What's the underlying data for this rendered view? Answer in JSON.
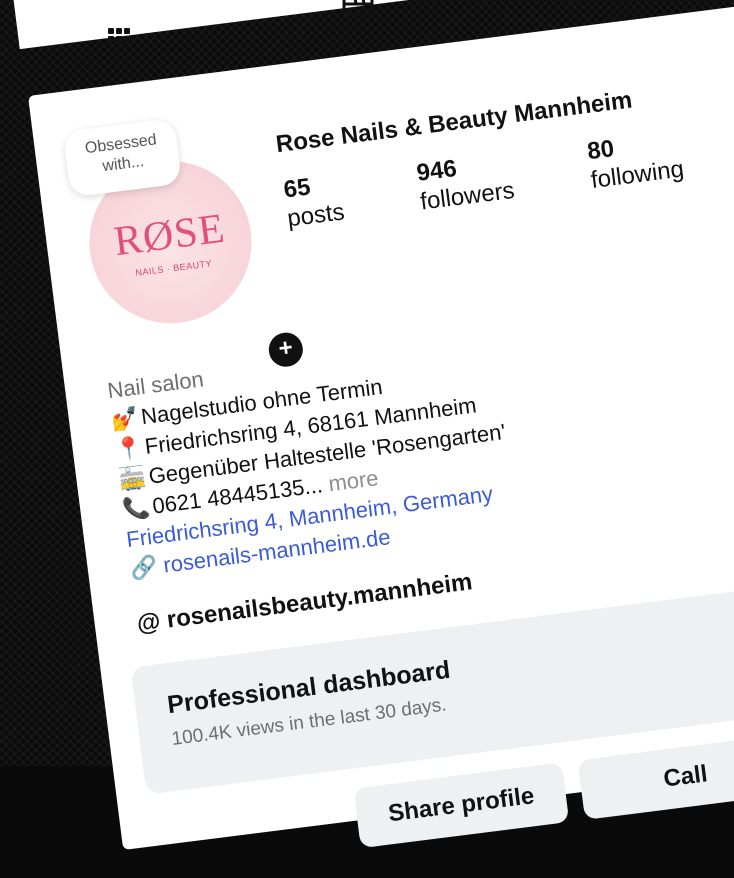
{
  "profile": {
    "name": "Rose Nails & Beauty Mannheim",
    "note": "Obsessed with...",
    "logo_text": "RØSE",
    "logo_sub": "NAILS · BEAUTY",
    "stats": [
      {
        "value": "65",
        "label": "posts"
      },
      {
        "value": "946",
        "label": "followers"
      },
      {
        "value": "80",
        "label": "following"
      }
    ]
  },
  "bio": {
    "category": "Nail salon",
    "lines": [
      {
        "icon": "nail-polish-icon",
        "text": "Nagelstudio ohne Termin"
      },
      {
        "icon": "pin-icon",
        "text": "Friedrichsring 4, 68161 Mannheim"
      },
      {
        "icon": "tram-icon",
        "text": "Gegenüber Haltestelle 'Rosengarten'"
      },
      {
        "icon": "phone-icon",
        "text": "0621 48445135...",
        "more": "more"
      }
    ],
    "address_link": "Friedrichsring 4, Mannheim, Germany",
    "website": "rosenails-mannheim.de",
    "threads_handle": "rosenailsbeauty.mannheim"
  },
  "dashboard": {
    "title": "Professional dashboard",
    "subtitle": "100.4K views in the last 30 days."
  },
  "buttons": {
    "share_label": "Share profile",
    "call_label": "Call"
  }
}
